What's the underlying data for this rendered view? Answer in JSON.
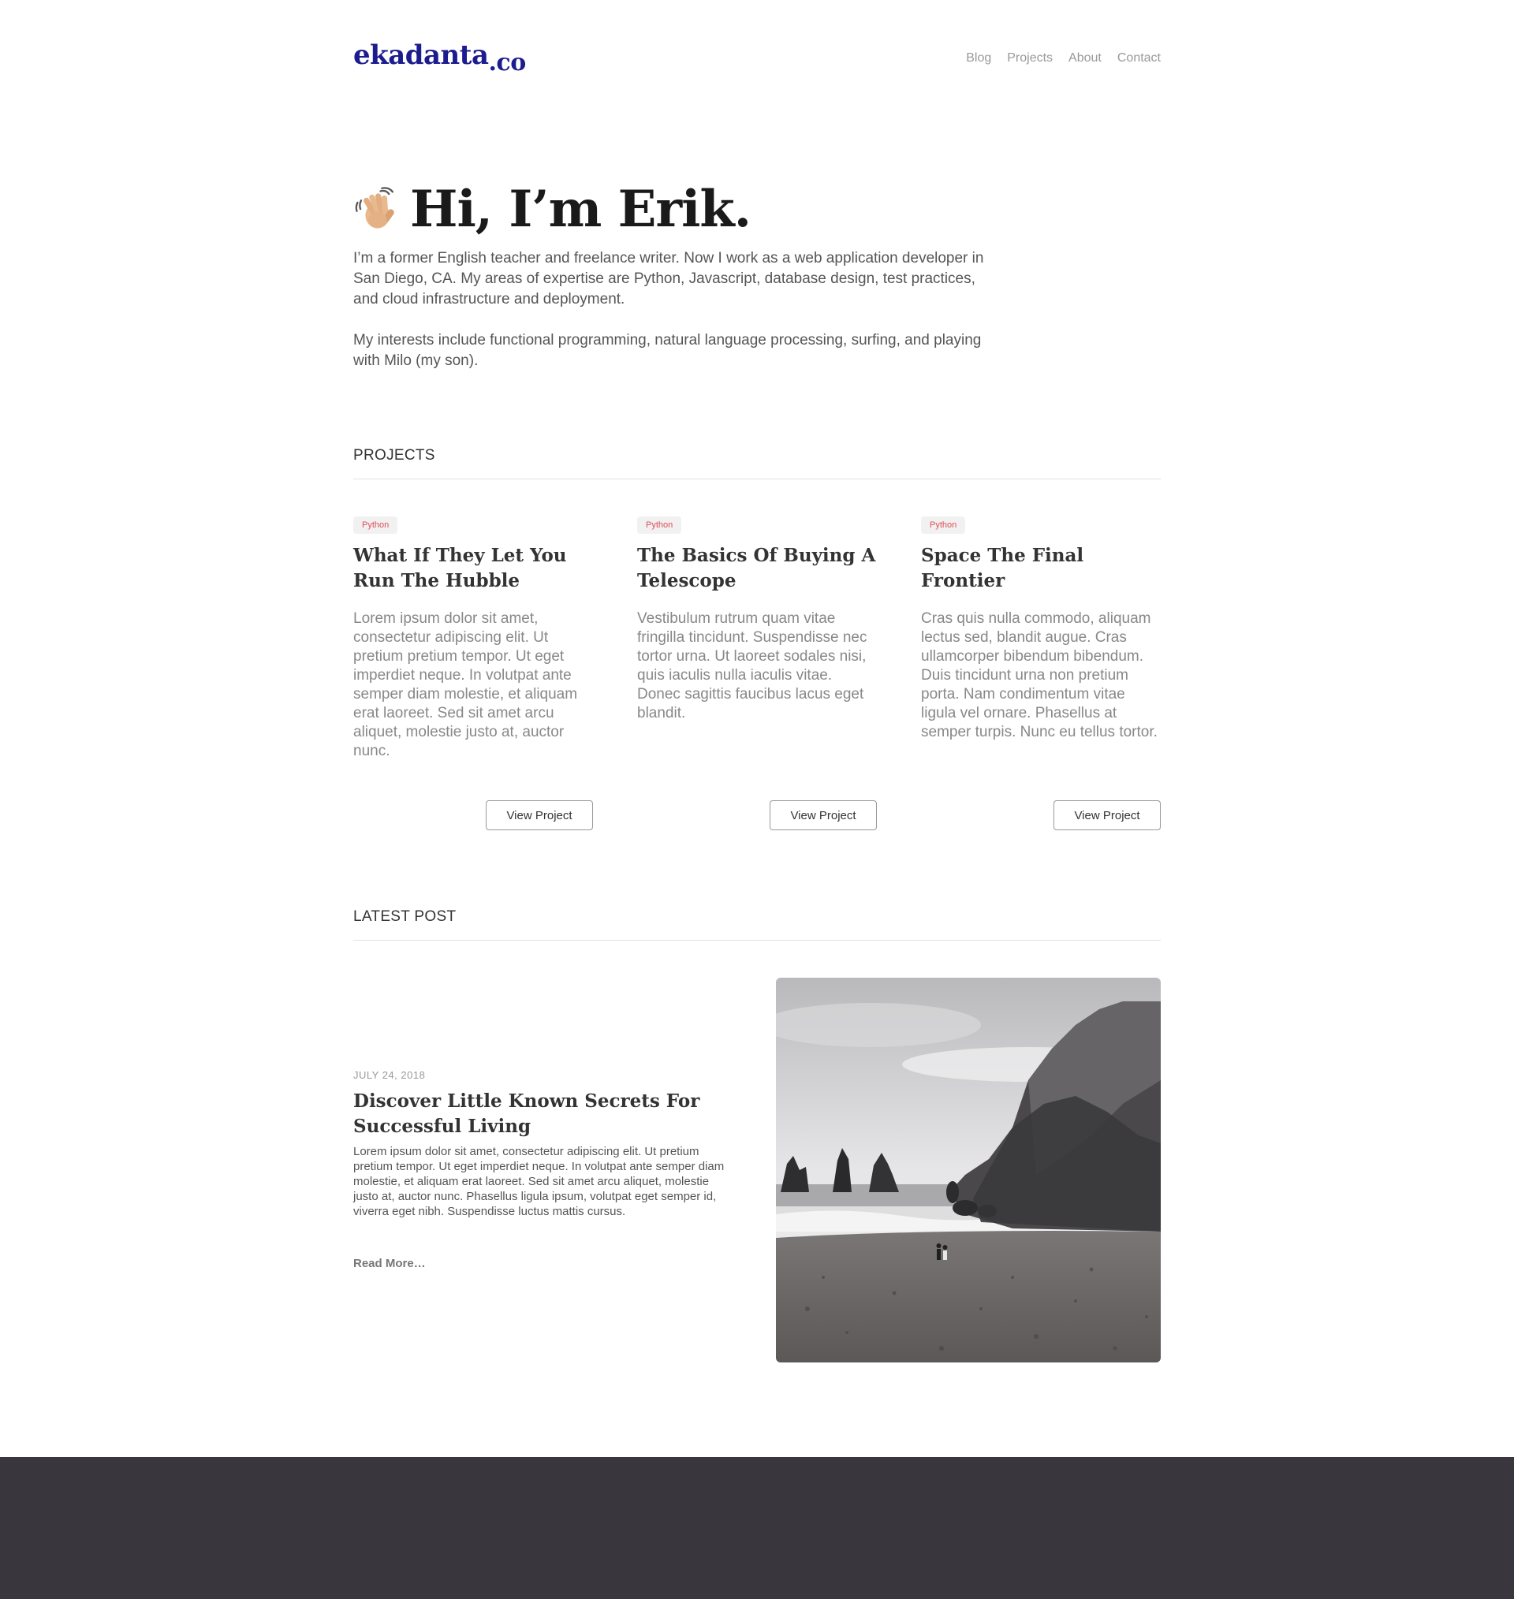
{
  "header": {
    "logo_main": "ekadanta",
    "logo_tld": ".co",
    "nav": [
      "Blog",
      "Projects",
      "About",
      "Contact"
    ]
  },
  "hero": {
    "icon": "waving-hand-icon",
    "title": "Hi, I’m Erik.",
    "paragraphs": [
      "I’m a former English teacher and freelance writer. Now I work as a web application developer in San Diego, CA. My areas of expertise are Python, Javascript, database design, test practices, and cloud infrastructure and deployment.",
      "My interests include functional programming, natural language processing, surfing, and playing with Milo (my son)."
    ]
  },
  "projects": {
    "heading": "PROJECTS",
    "items": [
      {
        "tag": "Python",
        "title": "What If They Let You Run The Hubble",
        "description": "Lorem ipsum dolor sit amet, consectetur adipiscing elit. Ut pretium pretium tempor. Ut eget imperdiet neque. In volutpat ante semper diam molestie, et aliquam erat laoreet. Sed sit amet arcu aliquet, molestie justo at, auctor nunc.",
        "button": "View Project"
      },
      {
        "tag": "Python",
        "title": "The Basics Of Buying A Telescope",
        "description": "Vestibulum rutrum quam vitae fringilla tincidunt. Suspendisse nec tortor urna. Ut laoreet sodales nisi, quis iaculis nulla iaculis vitae. Donec sagittis faucibus lacus eget blandit.",
        "button": "View Project"
      },
      {
        "tag": "Python",
        "title": "Space The Final Frontier",
        "description": "Cras quis nulla commodo, aliquam lectus sed, blandit augue. Cras ullamcorper bibendum bibendum. Duis tincidunt urna non pretium porta. Nam condimentum vitae ligula vel ornare. Phasellus at semper turpis. Nunc eu tellus tortor.",
        "button": "View Project"
      }
    ]
  },
  "latest_post": {
    "heading": "LATEST POST",
    "date": "JULY 24, 2018",
    "title": "Discover Little Known Secrets For Successful Living",
    "excerpt": "Lorem ipsum dolor sit amet, consectetur adipiscing elit. Ut pretium pretium tempor. Ut eget imperdiet neque. In volutpat ante semper diam molestie, et aliquam erat laoreet. Sed sit amet arcu aliquet, molestie justo at, auctor nunc. Phasellus ligula ipsum, volutpat eget semper id, viverra eget nibh. Suspendisse luctus mattis cursus.",
    "read_more": "Read More…",
    "image": "black-and-white-beach-cliffs-photo"
  },
  "colors": {
    "logo": "#1c1c8f",
    "tag_text": "#e04e58",
    "tag_bg": "#f1f1f1",
    "footer_bg": "#3a363d"
  }
}
